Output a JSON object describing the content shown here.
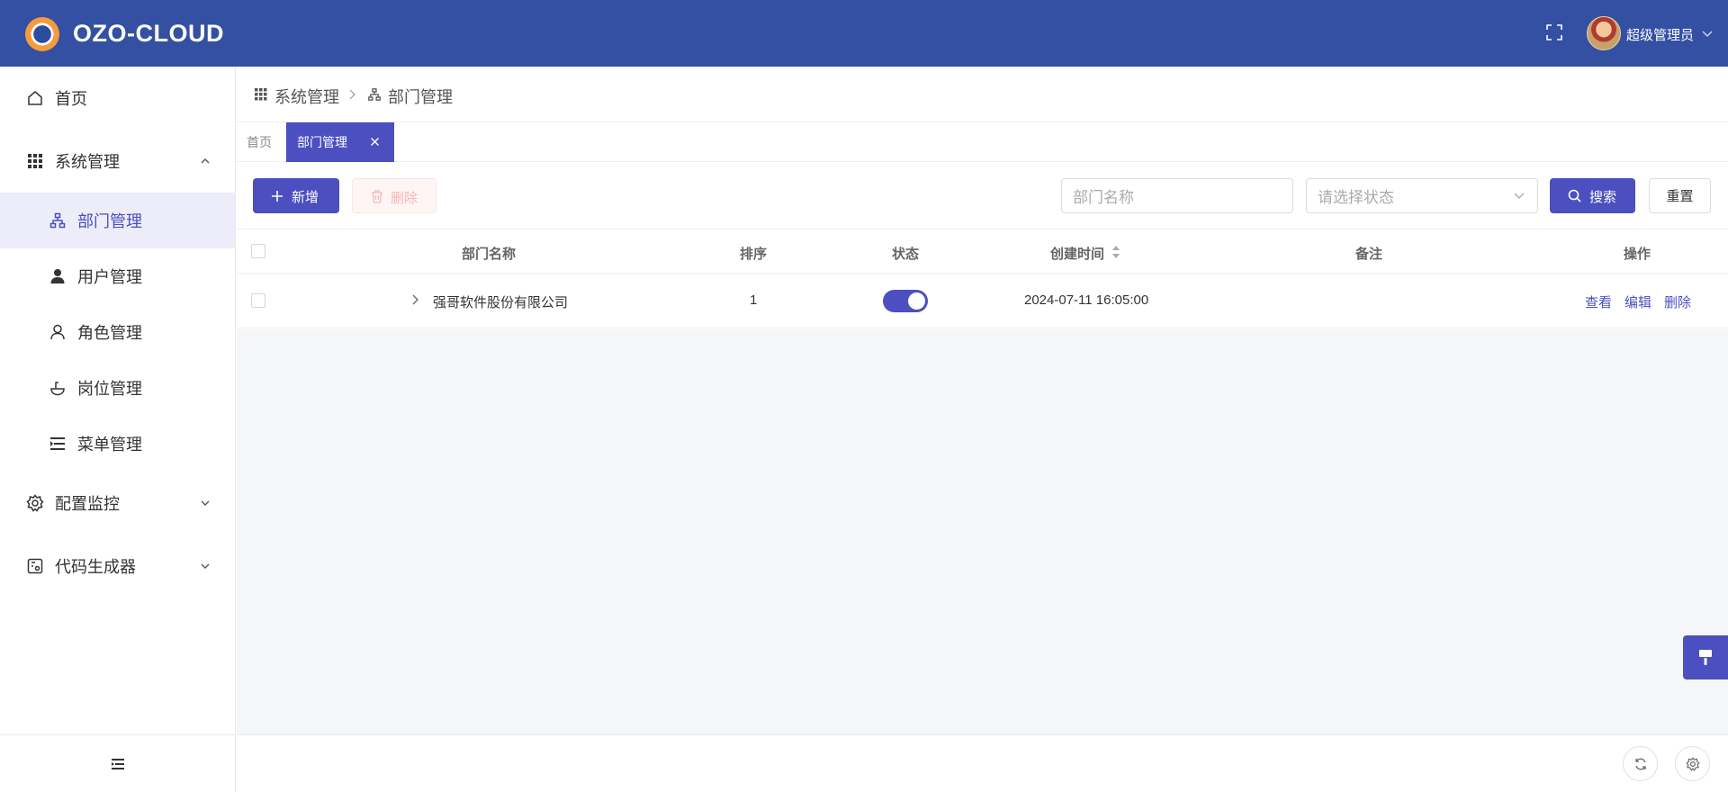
{
  "header": {
    "app_title": "OZO-CLOUD",
    "user_name": "超级管理员",
    "bg_color": "#3350a2"
  },
  "sidebar": {
    "items": [
      {
        "label": "首页",
        "icon": "home-icon"
      },
      {
        "label": "系统管理",
        "icon": "grid-icon",
        "expanded": true
      },
      {
        "label": "配置监控",
        "icon": "gear-icon",
        "expanded": false
      },
      {
        "label": "代码生成器",
        "icon": "code-icon",
        "expanded": false
      }
    ],
    "submenu": [
      {
        "label": "部门管理",
        "icon": "org-icon",
        "active": true
      },
      {
        "label": "用户管理",
        "icon": "user-icon"
      },
      {
        "label": "角色管理",
        "icon": "role-icon"
      },
      {
        "label": "岗位管理",
        "icon": "post-icon"
      },
      {
        "label": "菜单管理",
        "icon": "menu-icon"
      }
    ]
  },
  "breadcrumb": {
    "items": [
      "系统管理",
      "部门管理"
    ]
  },
  "tabs": {
    "home_label": "首页",
    "active_label": "部门管理"
  },
  "toolbar": {
    "add_label": "新增",
    "delete_label": "删除",
    "search_label": "搜索",
    "reset_label": "重置",
    "name_placeholder": "部门名称",
    "status_placeholder": "请选择状态"
  },
  "table": {
    "headers": [
      "部门名称",
      "排序",
      "状态",
      "创建时间",
      "备注",
      "操作"
    ],
    "rows": [
      {
        "name": "强哥软件股份有限公司",
        "sort": "1",
        "status_enabled": true,
        "created_at": "2024-07-11 16:05:00",
        "remark": "",
        "actions": [
          "查看",
          "编辑",
          "删除"
        ]
      }
    ]
  },
  "colors": {
    "primary": "#4b4fbf",
    "header": "#3350a2",
    "active_bg": "#ecedf8"
  }
}
